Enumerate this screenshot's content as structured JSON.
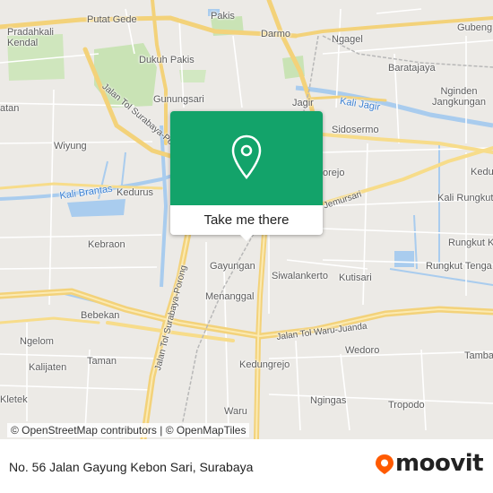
{
  "map": {
    "labels": [
      {
        "id": "pakis",
        "text": "Pakis",
        "kind": "place"
      },
      {
        "id": "putat-gede",
        "text": "Putat Gede",
        "kind": "place"
      },
      {
        "id": "pradahkali-kendal",
        "text": "Pradahkali\nKendal",
        "kind": "place"
      },
      {
        "id": "darmo",
        "text": "Darmo",
        "kind": "place"
      },
      {
        "id": "ngagel",
        "text": "Ngagel",
        "kind": "place"
      },
      {
        "id": "gubeng",
        "text": "Gubeng",
        "kind": "place"
      },
      {
        "id": "baratajaya",
        "text": "Baratajaya",
        "kind": "place"
      },
      {
        "id": "dukuh-pakis",
        "text": "Dukuh Pakis",
        "kind": "place"
      },
      {
        "id": "gunungsari",
        "text": "Gunungsari",
        "kind": "place"
      },
      {
        "id": "jagir",
        "text": "Jagir",
        "kind": "place"
      },
      {
        "id": "kali-jagir",
        "text": "Kali Jagir",
        "kind": "water"
      },
      {
        "id": "nginden",
        "text": "Nginden\nJangkungan",
        "kind": "place"
      },
      {
        "id": "patan",
        "text": "atan",
        "kind": "place"
      },
      {
        "id": "wiyung",
        "text": "Wiyung",
        "kind": "place"
      },
      {
        "id": "sidosermo",
        "text": "Sidosermo",
        "kind": "place"
      },
      {
        "id": "kali-brantas",
        "text": "Kali Brantas",
        "kind": "water"
      },
      {
        "id": "kedurus",
        "text": "Kedurus",
        "kind": "place"
      },
      {
        "id": "orejo",
        "text": "orejo",
        "kind": "place"
      },
      {
        "id": "jemursari",
        "text": "Jemursari",
        "kind": "road"
      },
      {
        "id": "kali-rungkut",
        "text": "Kali Rungkut",
        "kind": "place"
      },
      {
        "id": "kedung",
        "text": "Kedu",
        "kind": "place"
      },
      {
        "id": "kebraon",
        "text": "Kebraon",
        "kind": "place"
      },
      {
        "id": "rungkut-kidul",
        "text": "Rungkut Kidul",
        "kind": "place"
      },
      {
        "id": "gayungan",
        "text": "Gayungan",
        "kind": "place"
      },
      {
        "id": "siwalankerto",
        "text": "Siwalankerto",
        "kind": "place"
      },
      {
        "id": "kutisari",
        "text": "Kutisari",
        "kind": "place"
      },
      {
        "id": "rungkut-tenga",
        "text": "Rungkut Tenga",
        "kind": "place"
      },
      {
        "id": "menanggal",
        "text": "Menanggal",
        "kind": "place"
      },
      {
        "id": "bebekan",
        "text": "Bebekan",
        "kind": "place"
      },
      {
        "id": "tol-waru-juanda",
        "text": "Jalan Tol Waru-Juanda",
        "kind": "road"
      },
      {
        "id": "ngelom",
        "text": "Ngelom",
        "kind": "place"
      },
      {
        "id": "wedoro",
        "text": "Wedoro",
        "kind": "place"
      },
      {
        "id": "taman",
        "text": "Taman",
        "kind": "place"
      },
      {
        "id": "tamba",
        "text": "Tamba",
        "kind": "place"
      },
      {
        "id": "kalijaten",
        "text": "Kalijaten",
        "kind": "place"
      },
      {
        "id": "kedungrejo",
        "text": "Kedungrejo",
        "kind": "place"
      },
      {
        "id": "kletek",
        "text": "Kletek",
        "kind": "place"
      },
      {
        "id": "ngingas",
        "text": "Ngingas",
        "kind": "place"
      },
      {
        "id": "tropodo",
        "text": "Tropodo",
        "kind": "place"
      },
      {
        "id": "waru",
        "text": "Waru",
        "kind": "place"
      },
      {
        "id": "tol-sby-porong-1",
        "text": "Jalan Tol Surabaya-Porong",
        "kind": "road"
      },
      {
        "id": "tol-sby-porong-2",
        "text": "Jalan Tol Surabaya-Porong",
        "kind": "road"
      }
    ]
  },
  "popup": {
    "button_label": "Take me there",
    "pin_icon": "location-pin-icon"
  },
  "attribution": "© OpenStreetMap contributors | © OpenMapTiles",
  "footer": {
    "address": "No. 56 Jalan Gayung Kebon Sari, Surabaya",
    "brand": "moovit",
    "brand_color": "#ff5a00"
  },
  "colors": {
    "map_bg": "#eceae6",
    "park": "#c9e3b5",
    "water": "#a9ccee",
    "major_road": "#f7dc8a",
    "popup_green": "#13a36a"
  }
}
